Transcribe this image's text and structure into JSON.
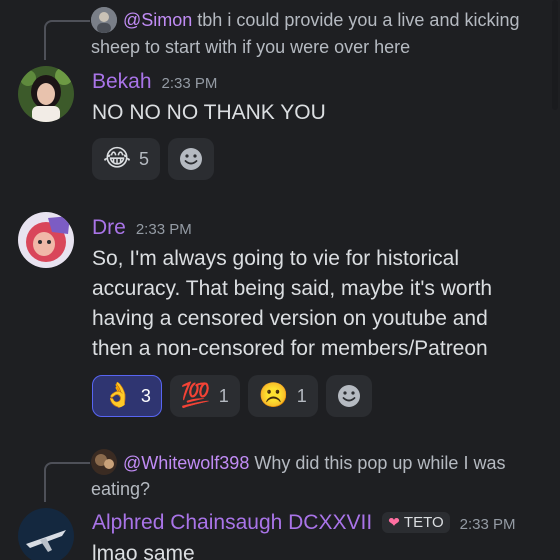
{
  "messages": [
    {
      "reply": {
        "mention": "@Simon",
        "text": " tbh i could provide you a live and kicking",
        "text_line2": "sheep to start with if you were over here"
      },
      "username": "Bekah",
      "time": "2:33 PM",
      "content": "NO NO NO THANK YOU",
      "reactions": [
        {
          "emoji": "😂",
          "count": "5"
        }
      ]
    },
    {
      "username": "Dre",
      "time": "2:33 PM",
      "content_lines": [
        "So, I'm always going to vie for historical",
        "accuracy. That being said, maybe it's worth",
        "having a censored version on youtube and",
        "then a non-censored for members/Patreon"
      ],
      "reactions": [
        {
          "emoji": "👌",
          "count": "3",
          "active": true
        },
        {
          "emoji": "💯",
          "count": "1"
        },
        {
          "emoji": "☹️",
          "count": "1"
        }
      ]
    },
    {
      "reply": {
        "mention": "@Whitewolf398",
        "text": " Why did this pop up while I was",
        "text_line2": "eating?"
      },
      "username": "Alphred Chainsaugh DCXXVII",
      "tag": "TETO",
      "time": "2:33 PM",
      "content": "lmao same"
    }
  ],
  "colors": {
    "background": "#1e1f22",
    "username": "#a974e8",
    "mention": "#c18cf5",
    "active_reaction": "#5865f2"
  }
}
